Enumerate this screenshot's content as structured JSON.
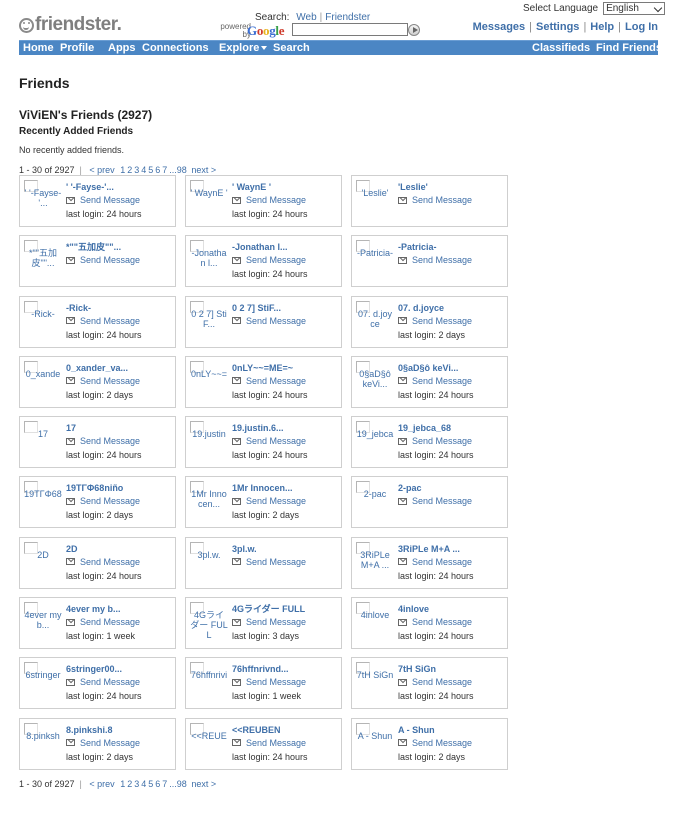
{
  "header": {
    "logo_text": "friendster.",
    "search": {
      "label": "Search:",
      "option_web": "Web",
      "option_friendster": "Friendster",
      "powered_by": "powered by",
      "google": [
        "G",
        "o",
        "o",
        "g",
        "l",
        "e"
      ],
      "query": ""
    },
    "language": {
      "label": "Select Language",
      "selected": "English"
    },
    "top_links": [
      "Messages",
      "Settings",
      "Help",
      "Log In"
    ]
  },
  "nav": {
    "items": [
      "Home",
      "Profile",
      "Apps",
      "Connections",
      "Explore",
      "Search",
      "Classifieds",
      "Find Friends"
    ]
  },
  "page": {
    "title": "Friends",
    "friends_heading": "ViViEN's Friends (2927)",
    "recent_heading": "Recently Added Friends",
    "no_recent": "No recently added friends."
  },
  "pager": {
    "range": "1 - 30 of 2927",
    "prev": "< prev",
    "pages": [
      "1",
      "2",
      "3",
      "4",
      "5",
      "6",
      "7",
      "...98"
    ],
    "next": "next >"
  },
  "send_message_label": "Send Message",
  "friends": [
    {
      "name": "' '-Fayse-'...",
      "thumb": "' '-Fayse-'...",
      "login": "last login: 24 hours"
    },
    {
      "name": "' WaynE '",
      "thumb": "' WaynE '",
      "login": "last login: 24 hours"
    },
    {
      "name": "'Leslie'",
      "thumb": "'Leslie'",
      "login": ""
    },
    {
      "name": "*\"\"五加皮\"\"...",
      "thumb": "*\"\"五加皮\"\"...",
      "login": ""
    },
    {
      "name": "-Jonathan l...",
      "thumb": "-Jonathan l...",
      "login": "last login: 24 hours"
    },
    {
      "name": "-Patricia-",
      "thumb": "-Patricia-",
      "login": ""
    },
    {
      "name": "-Rick-",
      "thumb": "-Rick-",
      "login": "last login: 24 hours"
    },
    {
      "name": "0 2 7] StiF...",
      "thumb": "0 2 7] StiF...",
      "login": ""
    },
    {
      "name": "07. d.joyce",
      "thumb": "07. d.joyce",
      "login": "last login: 2 days"
    },
    {
      "name": "0_xander_va...",
      "thumb": "0_xande",
      "login": "last login: 2 days"
    },
    {
      "name": "0nLY~~=ME=~",
      "thumb": "0nLY~~=",
      "login": "last login: 24 hours"
    },
    {
      "name": "0§aD§ô keVi...",
      "thumb": "0§aD§ô keVi...",
      "login": "last login: 24 hours"
    },
    {
      "name": "17",
      "thumb": "17",
      "login": "last login: 24 hours"
    },
    {
      "name": "19.justin.6...",
      "thumb": "19.justin",
      "login": "last login: 24 hours"
    },
    {
      "name": "19_jebca_68",
      "thumb": "19_jebca",
      "login": "last login: 24 hours"
    },
    {
      "name": "19TΓΦ68niño",
      "thumb": "19TΓΦ68",
      "login": "last login: 2 days"
    },
    {
      "name": "1Mr Innocen...",
      "thumb": "1Mr Innocen...",
      "login": "last login: 2 days"
    },
    {
      "name": "2-pac",
      "thumb": "2-pac",
      "login": ""
    },
    {
      "name": "2D",
      "thumb": "2D",
      "login": "last login: 24 hours"
    },
    {
      "name": "3pl.w.",
      "thumb": "3pl.w.",
      "login": ""
    },
    {
      "name": "3RiPLe M+A ...",
      "thumb": "3RiPLe M+A ...",
      "login": "last login: 24 hours"
    },
    {
      "name": "4ever my b...",
      "thumb": "4ever my b...",
      "login": "last login: 1 week"
    },
    {
      "name": "4Gライダー FULL",
      "thumb": "4Gライダー FULL",
      "login": "last login: 3 days"
    },
    {
      "name": "4inlove",
      "thumb": "4inlove",
      "login": "last login: 24 hours"
    },
    {
      "name": "6stringer00...",
      "thumb": "6stringer",
      "login": "last login: 24 hours"
    },
    {
      "name": "76hffnrivnd...",
      "thumb": "76hffnrivi",
      "login": "last login: 1 week"
    },
    {
      "name": "7tH SiGn",
      "thumb": "7tH SiGn",
      "login": "last login: 24 hours"
    },
    {
      "name": "8.pinkshi.8",
      "thumb": "8.pinksh",
      "login": "last login: 2 days"
    },
    {
      "name": "<<REUBEN",
      "thumb": "<<REUE",
      "login": "last login: 24 hours"
    },
    {
      "name": "A - Shun",
      "thumb": "A - Shun",
      "login": "last login: 2 days"
    }
  ]
}
